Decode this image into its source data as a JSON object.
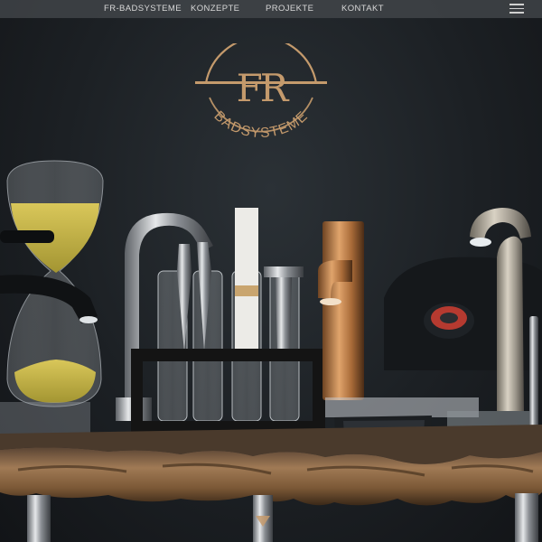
{
  "nav": {
    "items": [
      {
        "label": "FR-BADSYSTEME"
      },
      {
        "label": "KONZEPTE"
      },
      {
        "label": "PROJEKTE"
      },
      {
        "label": "KONTAKT"
      }
    ],
    "menu_icon": "hamburger-menu-icon"
  },
  "logo": {
    "monogram": "FR",
    "wordmark": "BADSYSTEME",
    "color": "#c49a6c"
  },
  "hero": {
    "scroll_icon": "chevron-down-icon"
  },
  "colors": {
    "background": "#1c2024",
    "nav_bar": "#464a4e",
    "nav_text": "#d7d7d7",
    "gold": "#c49a6c",
    "copper": "#b77a45"
  }
}
